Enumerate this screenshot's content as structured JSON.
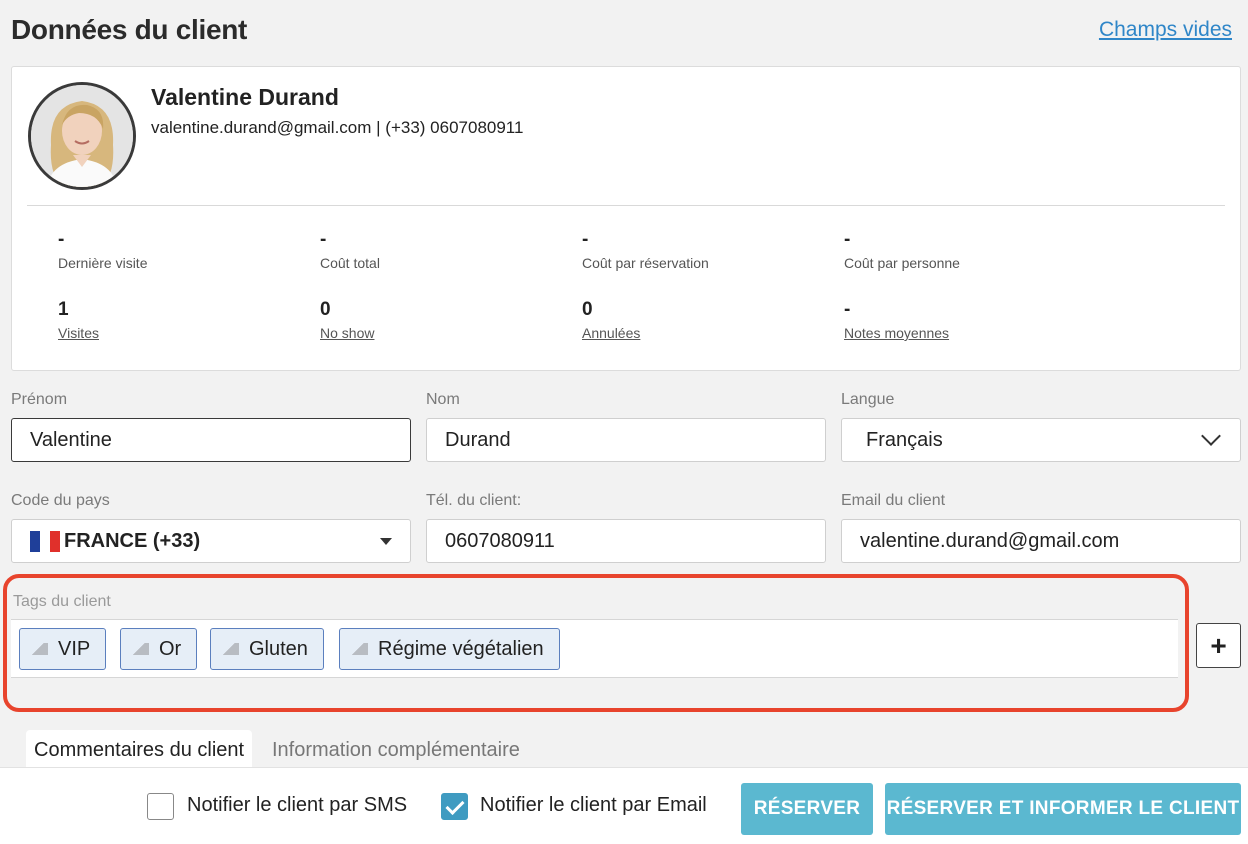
{
  "header": {
    "title": "Données du client",
    "empty_fields_link": "Champs vides"
  },
  "client": {
    "name": "Valentine Durand",
    "contact": "valentine.durand@gmail.com | (+33) 0607080911"
  },
  "stats": [
    {
      "value": "-",
      "label": "Dernière visite"
    },
    {
      "value": "-",
      "label": "Coût total"
    },
    {
      "value": "-",
      "label": "Coût par réservation"
    },
    {
      "value": "-",
      "label": "Coût par personne"
    },
    {
      "value": "1",
      "label": "Visites"
    },
    {
      "value": "0",
      "label": "No show"
    },
    {
      "value": "0",
      "label": "Annulées"
    },
    {
      "value": "-",
      "label": "Notes moyennes"
    }
  ],
  "form": {
    "first_name": {
      "label": "Prénom",
      "value": "Valentine"
    },
    "last_name": {
      "label": "Nom",
      "value": "Durand"
    },
    "language": {
      "label": "Langue",
      "value": "Français"
    },
    "country_code": {
      "label": "Code du pays",
      "value": "FRANCE (+33)"
    },
    "phone": {
      "label": "Tél. du client:",
      "value": "0607080911"
    },
    "email": {
      "label": "Email du client",
      "value": "valentine.durand@gmail.com"
    }
  },
  "tags": {
    "label": "Tags du client",
    "items": [
      "VIP",
      "Or",
      "Gluten",
      "Régime végétalien"
    ],
    "add_label": "+"
  },
  "tabs": [
    "Commentaires du client",
    "Information complémentaire"
  ],
  "footer": {
    "sms_label": "Notifier le client par SMS",
    "sms_checked": false,
    "email_label": "Notifier le client par Email",
    "email_checked": true,
    "reserve_button": "RÉSERVER",
    "reserve_inform_button": "RÉSERVER ET INFORMER LE CLIENT"
  },
  "colors": {
    "accent_button": "#5bb8d0",
    "highlight_outline": "#e8442d",
    "link": "#2f86c8",
    "tag_border": "#5b7fbe"
  },
  "flag_colors": [
    "#1f3f99",
    "#ffffff",
    "#e0302b"
  ]
}
